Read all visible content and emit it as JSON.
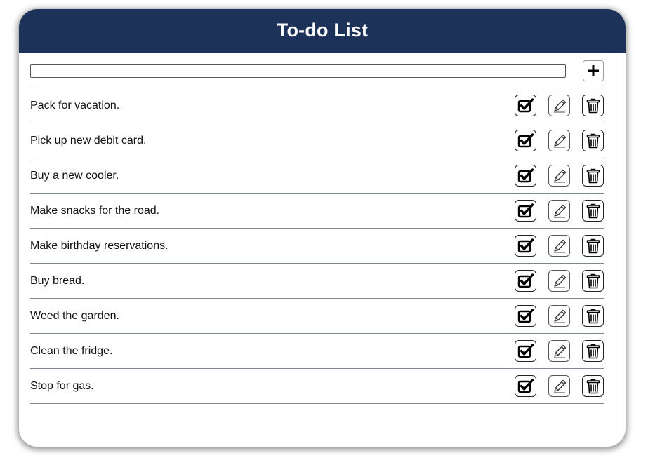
{
  "app": {
    "title": "To-do List"
  },
  "new_item": {
    "value": "",
    "placeholder": ""
  },
  "icons": {
    "add": "plus-icon",
    "complete": "checkbox-check-icon",
    "edit": "pencil-icon",
    "delete": "trash-icon"
  },
  "colors": {
    "header": "#1c3258",
    "divider": "#7d8794"
  },
  "items": [
    {
      "text": "Pack for vacation."
    },
    {
      "text": "Pick up new debit card."
    },
    {
      "text": "Buy a new cooler."
    },
    {
      "text": "Make snacks for the road."
    },
    {
      "text": "Make birthday reservations."
    },
    {
      "text": "Buy bread."
    },
    {
      "text": "Weed the garden."
    },
    {
      "text": "Clean the fridge."
    },
    {
      "text": "Stop for gas."
    }
  ]
}
